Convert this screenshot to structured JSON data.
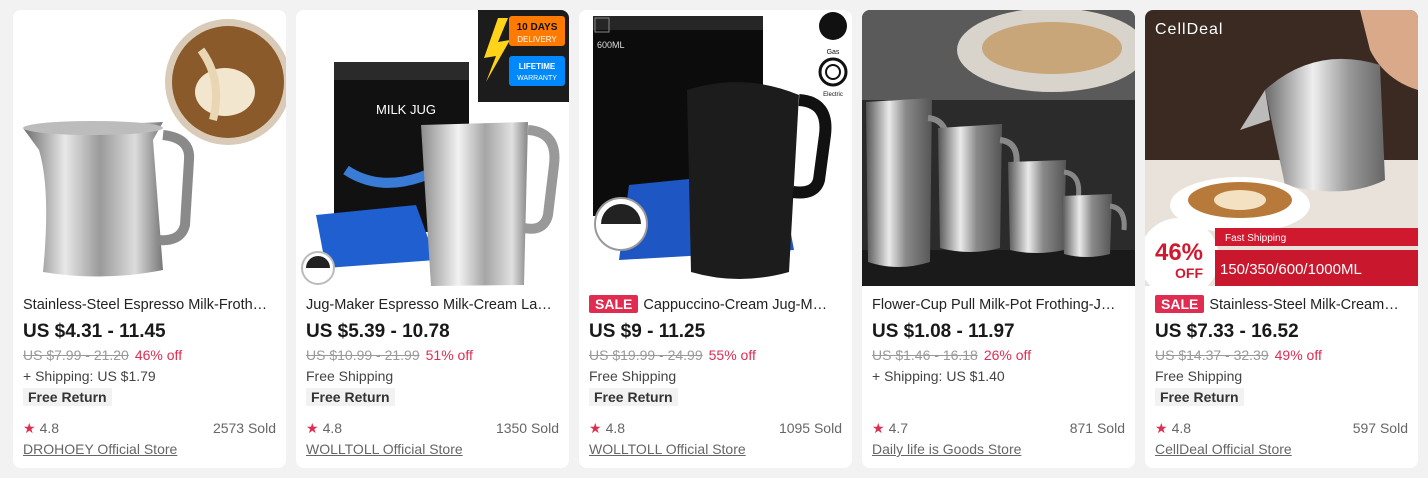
{
  "products": [
    {
      "title": "Stainless-Steel Espresso Milk-Froth…",
      "sale": "",
      "price": "US $4.31 - 11.45",
      "original": "US $7.99 - 21.20",
      "discount": "46% off",
      "shipping": "+ Shipping: US $1.79",
      "free_return": "Free Return",
      "rating": "4.8",
      "sold": "2573 Sold",
      "store": "DROHOEY Official Store"
    },
    {
      "title": "Jug-Maker Espresso Milk-Cream La…",
      "sale": "",
      "price": "US $5.39 - 10.78",
      "original": "US $10.99 - 21.99",
      "discount": "51% off",
      "shipping": "Free Shipping",
      "free_return": "Free Return",
      "rating": "4.8",
      "sold": "1350 Sold",
      "store": "WOLLTOLL Official Store",
      "image_text": {
        "badge_days": "10 DAYS",
        "badge_delivery": "DELIVERY",
        "badge_lifetime": "LIFETIME",
        "badge_warranty": "WARRANTY",
        "box_label": "MILK JUG"
      }
    },
    {
      "title": "Cappuccino-Cream Jug-M…",
      "sale": "SALE",
      "price": "US $9 - 11.25",
      "original": "US $19.99 - 24.99",
      "discount": "55% off",
      "shipping": "Free Shipping",
      "free_return": "Free Return",
      "rating": "4.8",
      "sold": "1095 Sold",
      "store": "WOLLTOLL Official Store",
      "image_text": {
        "capacity": "600ML",
        "gas": "Gas",
        "electric": "Electric"
      }
    },
    {
      "title": "Flower-Cup Pull Milk-Pot Frothing-J…",
      "sale": "",
      "price": "US $1.08 - 11.97",
      "original": "US $1.46 - 16.18",
      "discount": "26% off",
      "shipping": "+ Shipping: US $1.40",
      "free_return": "",
      "rating": "4.7",
      "sold": "871 Sold",
      "store": "Daily life is Goods Store"
    },
    {
      "title": "Stainless-Steel Milk-Cream…",
      "sale": "SALE",
      "price": "US $7.33 - 16.52",
      "original": "US $14.37 - 32.39",
      "discount": "49% off",
      "shipping": "Free Shipping",
      "free_return": "Free Return",
      "rating": "4.8",
      "sold": "597 Sold",
      "store": "CellDeal Official Store",
      "image_text": {
        "brand": "CellDeal",
        "percent": "46%",
        "off": "OFF",
        "fast_shipping": "Fast Shipping",
        "sizes": "150/350/600/1000ML"
      }
    }
  ],
  "colors": {
    "accent": "#e02c50",
    "price": "#191919",
    "muted": "#999999"
  },
  "icons": {
    "rating": "star-icon"
  }
}
